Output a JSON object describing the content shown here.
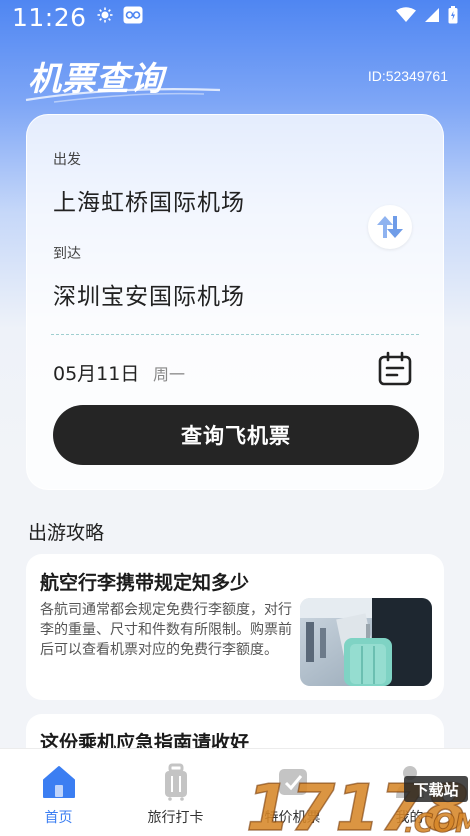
{
  "status_bar": {
    "time": "11:26"
  },
  "header": {
    "title": "机票查询",
    "user_id": "ID:52349761"
  },
  "search": {
    "depart_label": "出发",
    "depart_value": "上海虹桥国际机场",
    "arrive_label": "到达",
    "arrive_value": "深圳宝安国际机场",
    "date": "05月11日",
    "weekday": "周一",
    "query_button": "查询飞机票"
  },
  "guides": {
    "section_title": "出游攻略",
    "items": [
      {
        "title": "航空行李携带规定知多少",
        "desc": "各航司通常都会规定免费行李额度，对行李的重量、尺寸和件数有所限制。购票前后可以查看机票对应的免费行李额度。"
      },
      {
        "title": "这份乘机应急指南请收好"
      }
    ]
  },
  "tabbar": {
    "items": [
      {
        "label": "首页"
      },
      {
        "label": "旅行打卡"
      },
      {
        "label": "特价机票"
      },
      {
        "label": "我的"
      }
    ]
  },
  "watermark": {
    "text": "17178",
    "subtext": "下载站",
    "suffix": ".COM"
  },
  "colors": {
    "accent": "#3b7ef2",
    "button_dark": "#252525",
    "header_blue": "#4f86f2"
  }
}
